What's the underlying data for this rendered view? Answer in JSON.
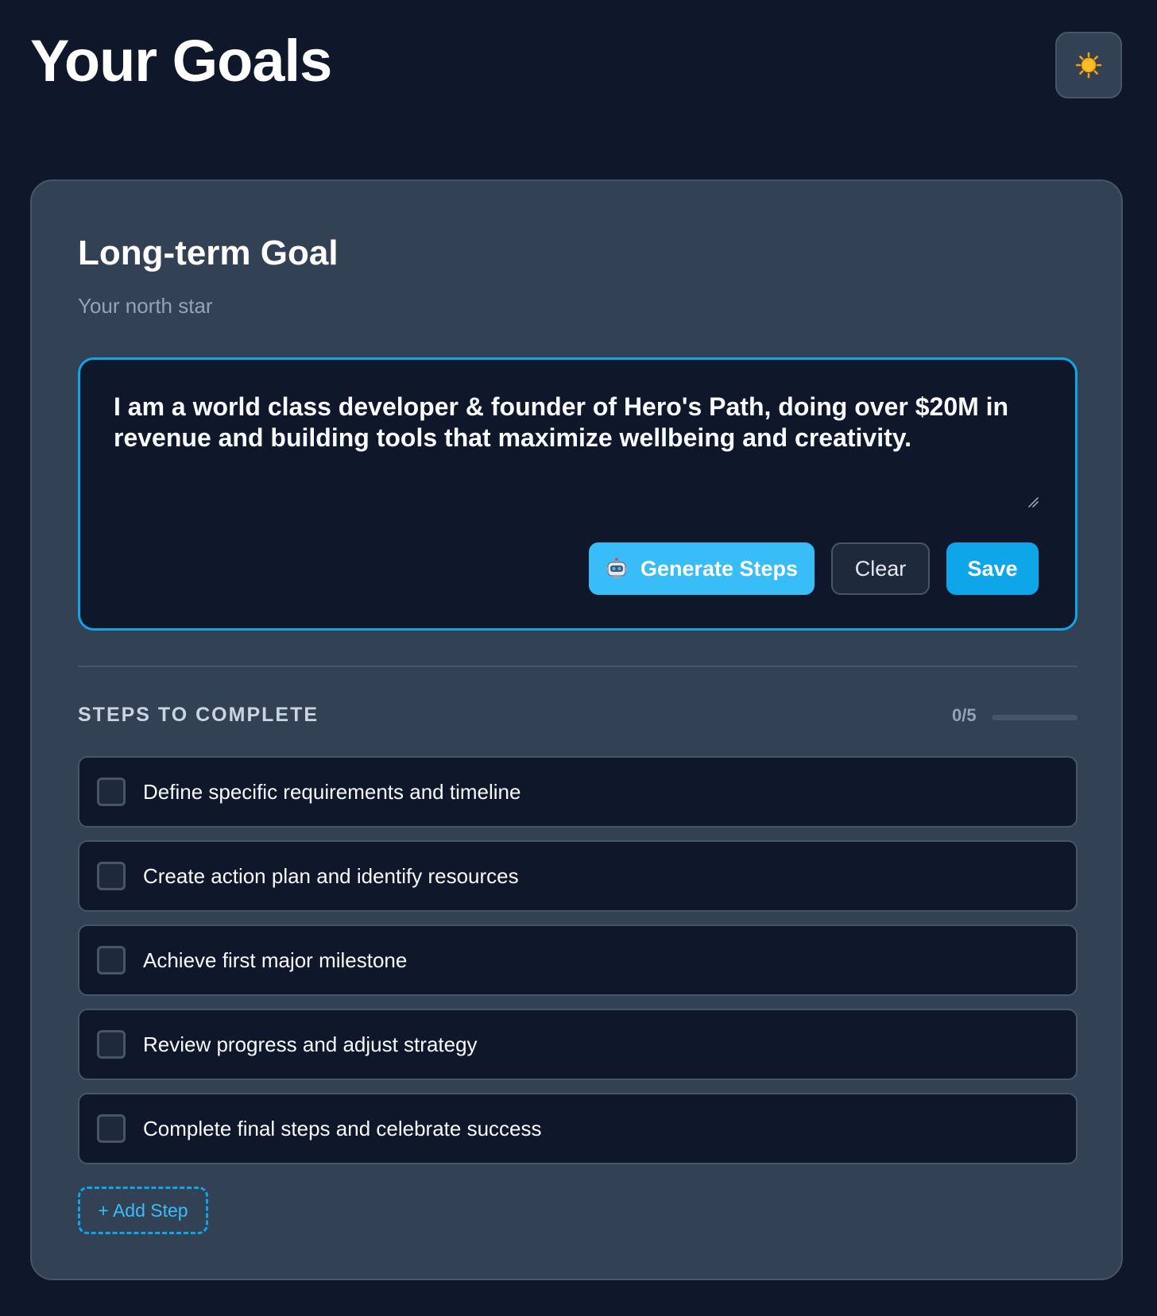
{
  "header": {
    "title": "Your Goals",
    "theme_toggle_icon": "sun-icon"
  },
  "goal_card": {
    "title": "Long-term Goal",
    "subtitle": "Your north star",
    "goal_text": "I am a world class developer & founder of Hero's Path, doing over $20M in revenue and building tools that maximize wellbeing and creativity.",
    "buttons": {
      "generate_icon": "robot-icon",
      "generate_label": "Generate Steps",
      "clear_label": "Clear",
      "save_label": "Save"
    }
  },
  "steps": {
    "heading": "STEPS TO COMPLETE",
    "progress_label": "0/5",
    "progress_fraction": 0,
    "items": [
      {
        "label": "Define specific requirements and timeline",
        "checked": false
      },
      {
        "label": "Create action plan and identify resources",
        "checked": false
      },
      {
        "label": "Achieve first major milestone",
        "checked": false
      },
      {
        "label": "Review progress and adjust strategy",
        "checked": false
      },
      {
        "label": "Complete final steps and celebrate success",
        "checked": false
      }
    ],
    "add_label": "+ Add Step"
  },
  "colors": {
    "background": "#0f172a",
    "card": "#334155",
    "accent": "#0ea5e9",
    "accent_light": "#38bdf8"
  }
}
